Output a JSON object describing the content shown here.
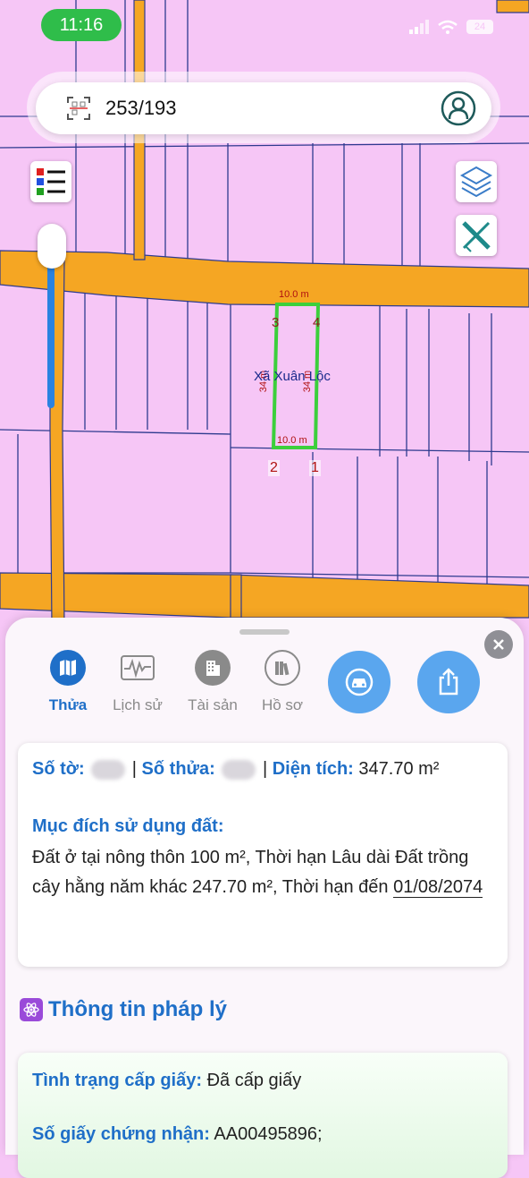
{
  "status_bar": {
    "time": "11:16",
    "battery": "24"
  },
  "search": {
    "value": "253/193"
  },
  "map": {
    "commune_label": "Xã Xuân Lộc",
    "edge_top": "10.0 m",
    "edge_bottom": "10.0 m",
    "edge_left": "34 m",
    "edge_right": "34 m",
    "vertex_1": "1",
    "vertex_2": "2",
    "vertex_3": "3",
    "vertex_4": "4",
    "zoom_level": 1.0,
    "icons": [
      "legend-icon",
      "layers-icon",
      "measure-icon"
    ]
  },
  "tabs": [
    {
      "label": "Thửa",
      "icon": "map-icon",
      "active": true
    },
    {
      "label": "Lịch sử",
      "icon": "history-icon",
      "active": false
    },
    {
      "label": "Tài sản",
      "icon": "building-icon",
      "active": false
    },
    {
      "label": "Hồ sơ",
      "icon": "books-icon",
      "active": false
    }
  ],
  "actions": [
    "car-icon",
    "share-icon"
  ],
  "parcel": {
    "sheet_label": "Số tờ:",
    "parcel_label": "Số thửa:",
    "separator": "|",
    "area_label": "Diện tích:",
    "area_value": "347.70 m²",
    "purpose_title": "Mục đích sử dụng đất:",
    "purpose_text": "Đất ở tại nông thôn 100 m², Thời hạn Lâu dài Đất trồng cây hằng năm khác 247.70 m², Thời hạn đến ",
    "purpose_date": "01/08/2074"
  },
  "legal": {
    "title": "Thông tin pháp lý",
    "status_label": "Tình trạng cấp giấy:",
    "status_value": "Đã cấp giấy",
    "cert_label": "Số giấy chứng nhận:",
    "cert_value": "AA00495896;"
  },
  "colors": {
    "land": "#f6c6f6",
    "road": "#f5a623",
    "accent": "#1f6fc8",
    "parcel_outline": "#3ccf3c"
  }
}
